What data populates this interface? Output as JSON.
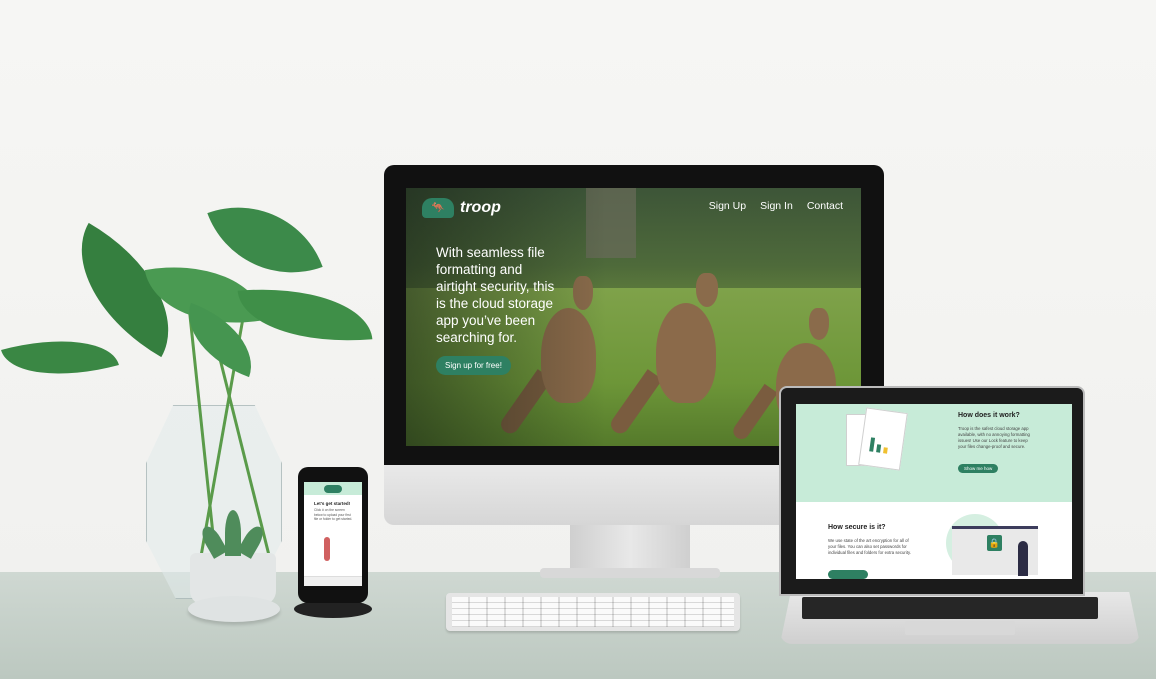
{
  "site": {
    "logo_text": "troop",
    "nav": [
      "Sign Up",
      "Sign In",
      "Contact"
    ],
    "hero_text": "With seamless file formatting and airtight security, this is the cloud storage app you’ve been searching for.",
    "hero_button": "Sign up for free!"
  },
  "laptop": {
    "section1_title": "How does it work?",
    "section1_text": "Troop is the safest cloud storage app available, with no annoying formatting issues! Use our Lock feature to keep your files change-proof and secure.",
    "section1_button": "Show me how",
    "section2_title": "How secure is it?",
    "section2_text": "We use state of the art encryption for all of your files. You can also set passwords for individual files and folders for extra security."
  },
  "phone": {
    "title": "Let's get started!",
    "text": "Click # on the screen below to upload your first file or folder to get started."
  },
  "colors": {
    "brand_green": "#2e8062",
    "mint": "#c7ebd8"
  }
}
